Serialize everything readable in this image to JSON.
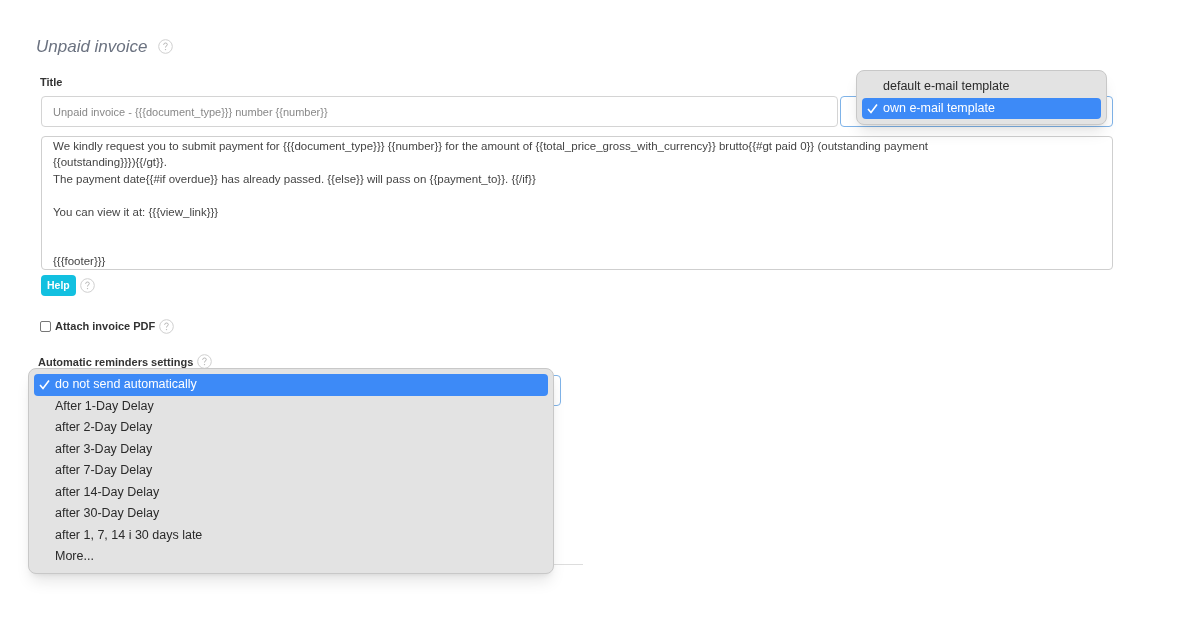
{
  "heading": "Unpaid invoice",
  "title_field": {
    "label": "Title",
    "value": "Unpaid invoice - {{{document_type}}} number {{number}}"
  },
  "template_select": {
    "options": [
      {
        "label": "default e-mail template",
        "selected": false
      },
      {
        "label": "own e-mail template",
        "selected": true
      }
    ]
  },
  "body_paragraphs": [
    [
      "We kindly request you to submit payment for {{{document_type}}} {{number}} for the amount of {{total_price_gross_with_currency}} brutto{{#gt paid 0}} (outstanding payment",
      "{{outstanding}}}){{/gt}}.",
      "The payment date{{#if overdue}} has already passed. {{else}} will pass on {{payment_to}}. {{/if}}"
    ],
    [
      "You can view it at: {{{view_link}}}"
    ],
    [
      "{{{footer}}}"
    ]
  ],
  "help_button": "Help",
  "attach_pdf": {
    "label": "Attach invoice PDF",
    "checked": false
  },
  "reminders": {
    "label": "Automatic reminders settings",
    "options": [
      {
        "label": "do not send automatically",
        "selected": true
      },
      {
        "label": "After 1-Day Delay",
        "selected": false
      },
      {
        "label": "after 2-Day Delay",
        "selected": false
      },
      {
        "label": "after 3-Day Delay",
        "selected": false
      },
      {
        "label": "after 7-Day Delay",
        "selected": false
      },
      {
        "label": "after 14-Day Delay",
        "selected": false
      },
      {
        "label": "after 30-Day Delay",
        "selected": false
      },
      {
        "label": "after 1, 7, 14 i 30 days late",
        "selected": false
      },
      {
        "label": "More...",
        "selected": false
      }
    ]
  }
}
